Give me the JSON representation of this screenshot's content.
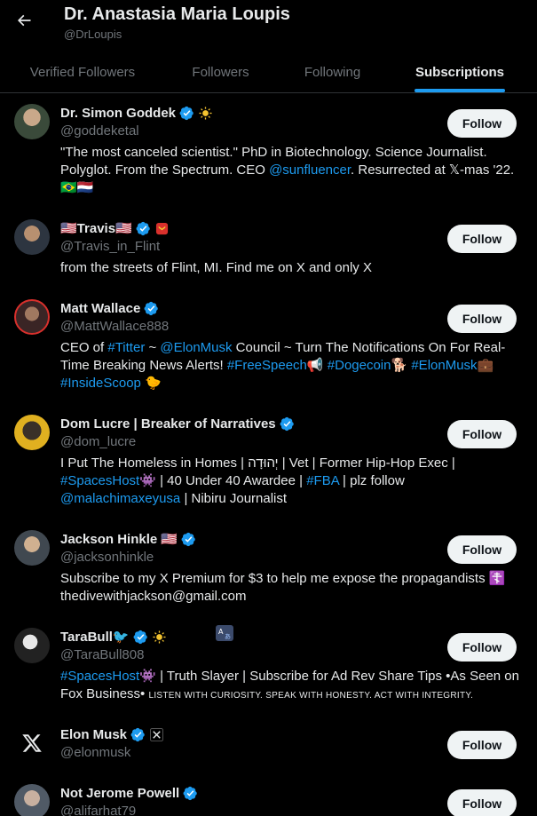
{
  "header": {
    "title": "Dr. Anastasia Maria Loupis",
    "handle": "@DrLoupis"
  },
  "tabs": [
    {
      "label": "Verified Followers",
      "active": false
    },
    {
      "label": "Followers",
      "active": false
    },
    {
      "label": "Following",
      "active": false
    },
    {
      "label": "Subscriptions",
      "active": true
    }
  ],
  "colors": {
    "accent": "#1d9bf0",
    "background": "#000000",
    "text": "#e7e9ea",
    "muted": "#71767b",
    "button_bg": "#eff3f4",
    "verified": "#1d9bf0"
  },
  "follow_label": "Follow",
  "accounts": [
    {
      "name": "Dr. Simon Goddek",
      "handle": "@goddeketal",
      "badges": [
        "verified-icon",
        "sun-icon"
      ],
      "bio_parts": [
        {
          "t": "\"The most canceled scientist.\" PhD in Biotechnology. Science Journalist. Polyglot. From the Spectrum. CEO "
        },
        {
          "t": "@sunfluencer",
          "link": true
        },
        {
          "t": ". Resurrected at 𝕏-mas '22."
        },
        {
          "t": "🇧🇷🇳🇱"
        }
      ]
    },
    {
      "name": "🇺🇸Travis🇺🇸",
      "handle": "@Travis_in_Flint",
      "badges": [
        "verified-icon",
        "affiliate-badge-icon"
      ],
      "bio_parts": [
        {
          "t": "from the streets of Flint, MI. Find me on X and only X"
        }
      ]
    },
    {
      "name": "Matt Wallace",
      "handle": "@MattWallace888",
      "badges": [
        "verified-icon"
      ],
      "bio_parts": [
        {
          "t": "CEO of "
        },
        {
          "t": "#Titter",
          "link": true
        },
        {
          "t": " ~ "
        },
        {
          "t": "@ElonMusk",
          "link": true
        },
        {
          "t": " Council ~ Turn The Notifications On For Real-Time Breaking News Alerts! "
        },
        {
          "t": "#FreeSpeech",
          "link": true
        },
        {
          "t": "📢 "
        },
        {
          "t": "#Dogecoin",
          "link": true
        },
        {
          "t": "🐕 "
        },
        {
          "t": "#ElonMusk",
          "link": true
        },
        {
          "t": "💼 "
        },
        {
          "t": "#InsideScoop",
          "link": true
        },
        {
          "t": " 🐤"
        }
      ]
    },
    {
      "name": "Dom Lucre | Breaker of Narratives",
      "handle": "@dom_lucre",
      "badges": [
        "verified-icon"
      ],
      "bio_parts": [
        {
          "t": "I Put The Homeless in Homes | יְהוּדָה | Vet | Former Hip-Hop Exec | "
        },
        {
          "t": "#SpacesHost",
          "link": true
        },
        {
          "t": "👾 | 40 Under 40 Awardee | "
        },
        {
          "t": "#FBA",
          "link": true
        },
        {
          "t": " | plz follow "
        },
        {
          "t": "@malachimaxeyusa",
          "link": true
        },
        {
          "t": " | Nibiru Journalist"
        }
      ]
    },
    {
      "name": "Jackson Hinkle 🇺🇸",
      "handle": "@jacksonhinkle",
      "badges": [
        "verified-icon"
      ],
      "bio_parts": [
        {
          "t": "Subscribe to my X Premium for $3 to help me expose the propagandists ☦️ thedivewithjackson@gmail.com"
        }
      ]
    },
    {
      "name": "TaraBull🐦",
      "handle": "@TaraBull808",
      "badges": [
        "verified-icon",
        "sun-icon"
      ],
      "bio_parts": [
        {
          "t": "#SpacesHost",
          "link": true
        },
        {
          "t": "👾 | Truth Slayer | Subscribe for Ad Rev Share Tips •As Seen on Fox Business• "
        },
        {
          "t": "LISTEN WITH CURIOSITY. SPEAK WITH HONESTY. ACT WITH INTEGRITY.",
          "small": true
        }
      ]
    },
    {
      "name": "Elon Musk",
      "handle": "@elonmusk",
      "badges": [
        "verified-icon",
        "x-affiliate-icon"
      ],
      "bio_parts": []
    },
    {
      "name": "Not Jerome Powell",
      "handle": "@alifarhat79",
      "badges": [
        "verified-icon"
      ],
      "bio_parts": []
    }
  ]
}
